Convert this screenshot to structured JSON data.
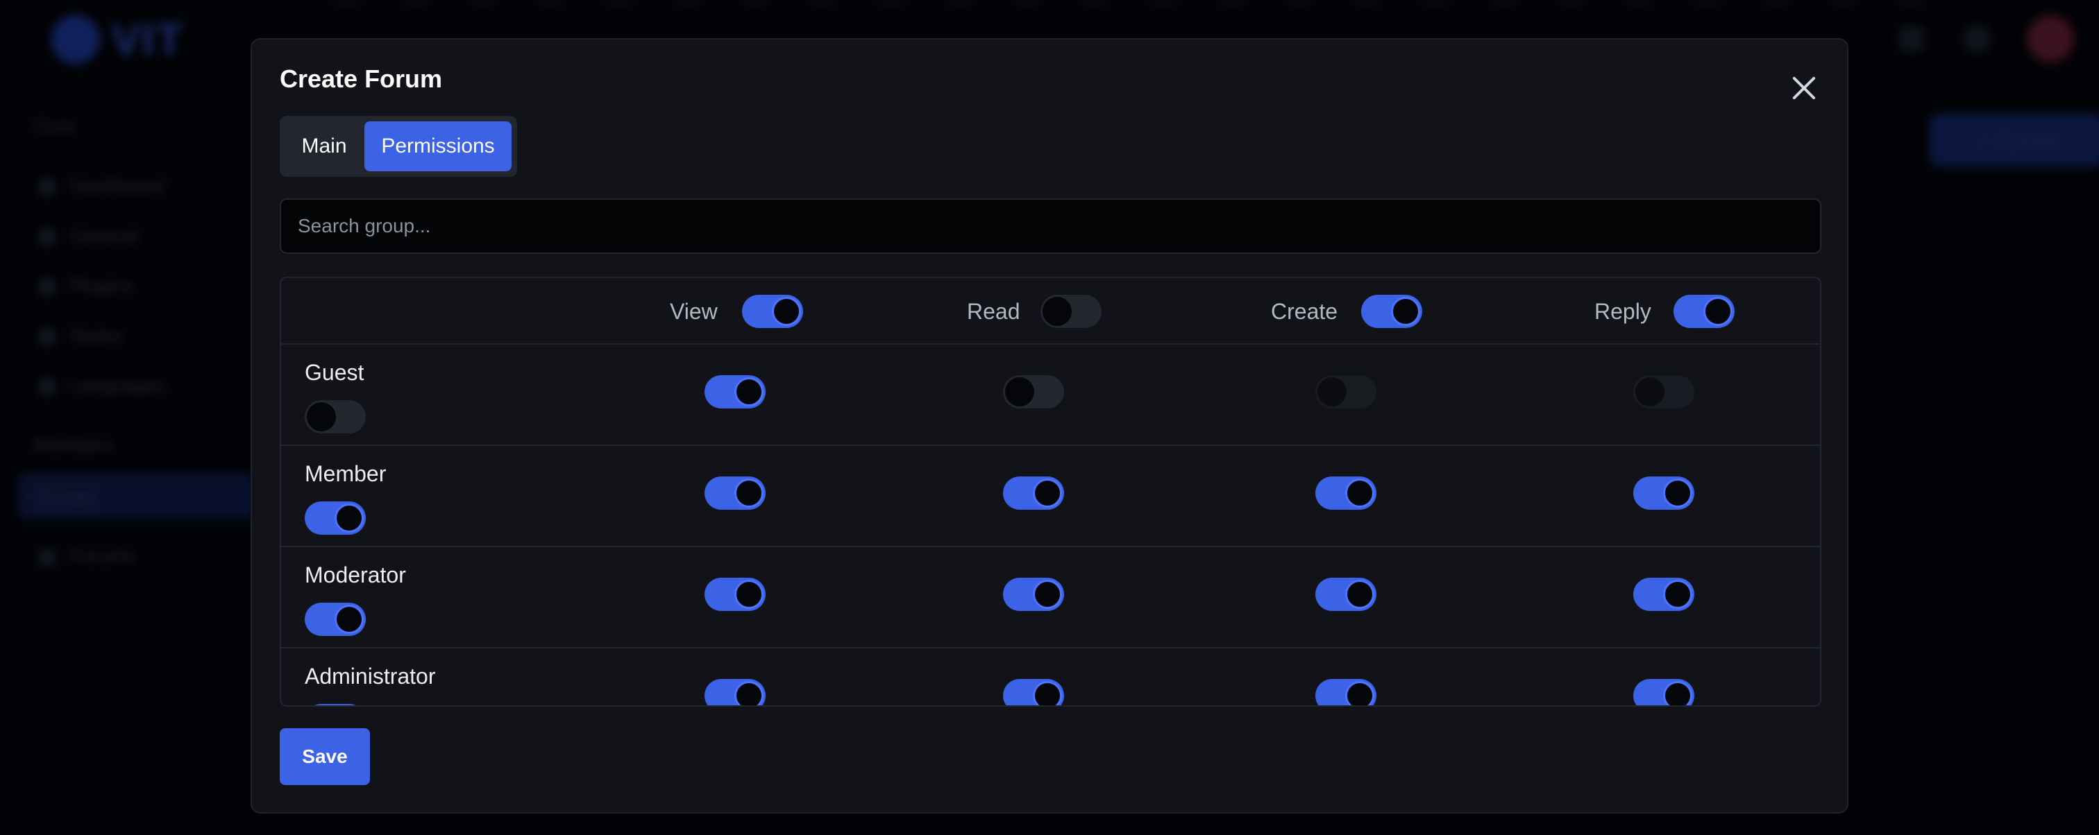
{
  "background": {
    "logo_text": "VIT",
    "sidebar": {
      "heading_1": "Core",
      "items_1": [
        "Dashboard",
        "General",
        "Plugins",
        "Styles",
        "Languages"
      ],
      "heading_2": "Members",
      "active_item": "Groups",
      "items_2": [
        "Forums"
      ]
    },
    "create_button_label": "+ Create"
  },
  "modal": {
    "title": "Create Forum",
    "close_icon": "close-icon",
    "tabs": [
      {
        "label": "Main",
        "active": false
      },
      {
        "label": "Permissions",
        "active": true
      }
    ],
    "search": {
      "placeholder": "Search group...",
      "value": ""
    },
    "table": {
      "columns": [
        {
          "label": "View",
          "all_on": true
        },
        {
          "label": "Read",
          "all_on": false
        },
        {
          "label": "Create",
          "all_on": true
        },
        {
          "label": "Reply",
          "all_on": true
        }
      ],
      "rows": [
        {
          "group": "Guest",
          "row_toggle": false,
          "perms": {
            "view": true,
            "read": false,
            "create": false,
            "reply": false
          },
          "disabled": {
            "create": true,
            "reply": true
          }
        },
        {
          "group": "Member",
          "row_toggle": true,
          "perms": {
            "view": true,
            "read": true,
            "create": true,
            "reply": true
          }
        },
        {
          "group": "Moderator",
          "row_toggle": true,
          "perms": {
            "view": true,
            "read": true,
            "create": true,
            "reply": true
          }
        },
        {
          "group": "Administrator",
          "row_toggle": true,
          "perms": {
            "view": true,
            "read": true,
            "create": true,
            "reply": true
          }
        }
      ]
    },
    "save_label": "Save"
  },
  "colors": {
    "accent": "#3c63e6",
    "modal_bg": "#111318",
    "page_bg": "#020306"
  }
}
